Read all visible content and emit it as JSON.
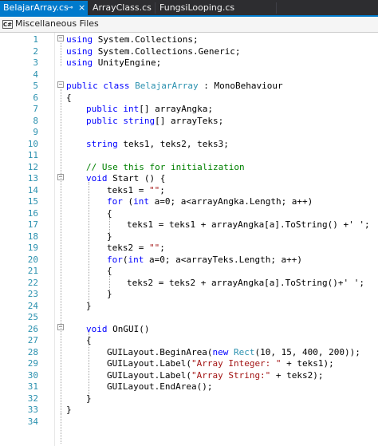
{
  "tabs": [
    {
      "label": "BelajarArray.cs",
      "active": true,
      "pin": "⊸",
      "close": "×"
    },
    {
      "label": "ArrayClass.cs",
      "active": false
    },
    {
      "label": "FungsiLooping.cs",
      "active": false
    }
  ],
  "navbar": {
    "icon_text": "C#",
    "label": "Miscellaneous Files"
  },
  "lines": [
    {
      "n": "1"
    },
    {
      "n": "2"
    },
    {
      "n": "3"
    },
    {
      "n": "4"
    },
    {
      "n": "5"
    },
    {
      "n": "6"
    },
    {
      "n": "7"
    },
    {
      "n": "8"
    },
    {
      "n": "9"
    },
    {
      "n": "10"
    },
    {
      "n": "11"
    },
    {
      "n": "12"
    },
    {
      "n": "13"
    },
    {
      "n": "14"
    },
    {
      "n": "15"
    },
    {
      "n": "16"
    },
    {
      "n": "17"
    },
    {
      "n": "18"
    },
    {
      "n": "19"
    },
    {
      "n": "20"
    },
    {
      "n": "21"
    },
    {
      "n": "22"
    },
    {
      "n": "23"
    },
    {
      "n": "24"
    },
    {
      "n": "25"
    },
    {
      "n": "26"
    },
    {
      "n": "27"
    },
    {
      "n": "28"
    },
    {
      "n": "29"
    },
    {
      "n": "30"
    },
    {
      "n": "31"
    },
    {
      "n": "32"
    },
    {
      "n": "33"
    },
    {
      "n": "34"
    }
  ],
  "code": {
    "l1": [
      "using",
      " System.Collections;"
    ],
    "l2": [
      "using",
      " System.Collections.Generic;"
    ],
    "l3": [
      "using",
      " UnityEngine;"
    ],
    "l5": [
      "public",
      " ",
      "class",
      " ",
      "BelajarArray",
      " : MonoBehaviour"
    ],
    "l6": "{",
    "l7": [
      "public",
      " ",
      "int",
      "[] arrayAngka;"
    ],
    "l8": [
      "public",
      " ",
      "string",
      "[] arrayTeks;"
    ],
    "l10": [
      "string",
      " teks1, teks2, teks3;"
    ],
    "l12": "// Use this for initialization",
    "l13": [
      "void",
      " Start () {"
    ],
    "l14": [
      "teks1 = ",
      "\"\"",
      ";"
    ],
    "l15": [
      "for",
      " (",
      "int",
      " a=0; a<arrayAngka.Length; a++)"
    ],
    "l16": "{",
    "l17": "teks1 = teks1 + arrayAngka[a].ToString() +' ';",
    "l18": "}",
    "l19": [
      "teks2 = ",
      "\"\"",
      ";"
    ],
    "l20": [
      "for",
      "(",
      "int",
      " a=0; a<arrayTeks.Length; a++)"
    ],
    "l21": "{",
    "l22": "teks2 = teks2 + arrayAngka[a].ToString()+' ';",
    "l23": "}",
    "l24": "}",
    "l26": [
      "void",
      " OnGUI()"
    ],
    "l27": "{",
    "l28": [
      "GUILayout.BeginArea(",
      "new",
      " ",
      "Rect",
      "(10, 15, 400, 200));"
    ],
    "l29": [
      "GUILayout.Label(",
      "\"Array Integer: \"",
      " + teks1);"
    ],
    "l30": [
      "GUILayout.Label(",
      "\"Array String:\"",
      " + teks2);"
    ],
    "l31": "GUILayout.EndArea();",
    "l32": "}",
    "l33": "}"
  },
  "colors": {
    "keyword": "#0000ff",
    "type": "#2b91af",
    "string": "#a31515",
    "comment": "#008000",
    "line_number": "#2b91af",
    "tab_active": "#007acc",
    "tab_bar": "#2d2d30"
  }
}
